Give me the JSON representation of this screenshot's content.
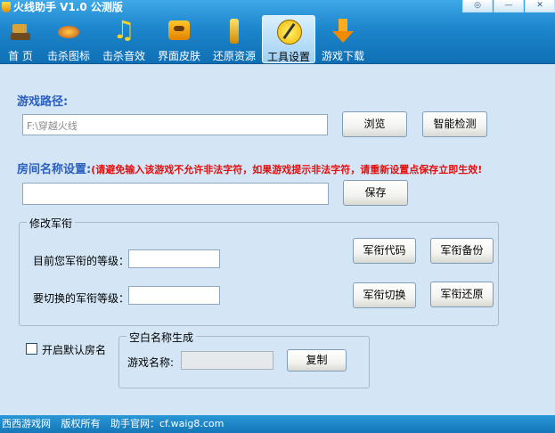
{
  "window": {
    "title": "火线助手 V1.0 公测版",
    "buttons": [
      "◎",
      "—",
      "✕"
    ]
  },
  "nav": [
    {
      "label": "首 页",
      "icon": "home-icon"
    },
    {
      "label": "击杀图标",
      "icon": "kill-icon-icon"
    },
    {
      "label": "击杀音效",
      "icon": "music-note-icon"
    },
    {
      "label": "界面皮肤",
      "icon": "skin-icon"
    },
    {
      "label": "还原资源",
      "icon": "restore-icon"
    },
    {
      "label": "工具设置",
      "icon": "tool-icon",
      "active": true
    },
    {
      "label": "游戏下载",
      "icon": "download-arrow-icon"
    }
  ],
  "game_path": {
    "title": "游戏路径:",
    "value": "F:\\穿越火线",
    "browse_label": "浏览",
    "detect_label": "智能检测"
  },
  "room_name": {
    "title": "房间名称设置:",
    "warning": "(请避免输入该游戏不允许非法字符，如果游戏提示非法字符，请重新设置点保存立即生效!",
    "value": "",
    "save_label": "保存"
  },
  "rank": {
    "legend": "修改军衔",
    "current_label": "目前您军衔的等级：",
    "switch_label": "要切换的军衔等级：",
    "current_value": "",
    "switch_value": "",
    "code_label": "军衔代码",
    "backup_label": "军衔备份",
    "switch_button_label": "军衔切换",
    "restore_label": "军衔还原"
  },
  "default_room": {
    "label": "开启默认房名",
    "checked": false
  },
  "blank_name": {
    "legend": "空白名称生成",
    "name_label": "游戏名称:",
    "value": "",
    "copy_label": "复制"
  },
  "status": {
    "items": [
      "西西游戏网",
      "版权所有",
      "助手官网：cf.waig8.com"
    ]
  }
}
